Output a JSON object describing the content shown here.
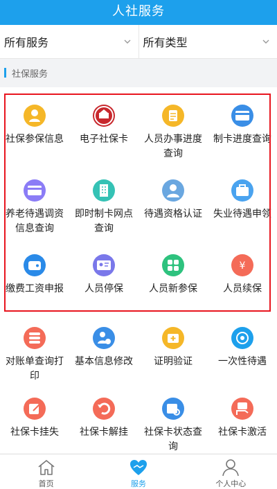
{
  "header": {
    "title": "人社服务"
  },
  "filters": {
    "service": "所有服务",
    "type": "所有类型"
  },
  "section": {
    "title": "社保服务"
  },
  "services": [
    {
      "label": "社保参保信息",
      "icon": "person-icon",
      "color": "#f5b728"
    },
    {
      "label": "电子社保卡",
      "icon": "emblem-icon",
      "color": "#c8282d"
    },
    {
      "label": "人员办事进度查询",
      "icon": "document-icon",
      "color": "#f5b728"
    },
    {
      "label": "制卡进度查询",
      "icon": "card-icon",
      "color": "#3a8ee6"
    },
    {
      "label": "养老待遇调资信息查询",
      "icon": "card-icon",
      "color": "#8b7cf6"
    },
    {
      "label": "即时制卡网点查询",
      "icon": "building-icon",
      "color": "#35c2b5"
    },
    {
      "label": "待遇资格认证",
      "icon": "doctor-icon",
      "color": "#6aa7e0"
    },
    {
      "label": "失业待遇申领",
      "icon": "briefcase-icon",
      "color": "#4aa3ef"
    },
    {
      "label": "缴费工资申报",
      "icon": "wallet-icon",
      "color": "#2a8ae8"
    },
    {
      "label": "人员停保",
      "icon": "id-card-icon",
      "color": "#7a78ea"
    },
    {
      "label": "人员新参保",
      "icon": "grid-icon",
      "color": "#2ec27e"
    },
    {
      "label": "人员续保",
      "icon": "yuan-hand-icon",
      "color": "#f46b58"
    },
    {
      "label": "对账单查询打印",
      "icon": "stack-icon",
      "color": "#f46b58"
    },
    {
      "label": "基本信息修改",
      "icon": "user-edit-icon",
      "color": "#3a8ee6"
    },
    {
      "label": "证明验证",
      "icon": "medical-box-icon",
      "color": "#f5b728"
    },
    {
      "label": "一次性待遇",
      "icon": "coin-icon",
      "color": "#1da0ec"
    },
    {
      "label": "社保卡挂失",
      "icon": "edit-icon",
      "color": "#f46b58"
    },
    {
      "label": "社保卡解挂",
      "icon": "undo-icon",
      "color": "#f46b58"
    },
    {
      "label": "社保卡状态查询",
      "icon": "calendar-search-icon",
      "color": "#3a8ee6"
    },
    {
      "label": "社保卡激活",
      "icon": "hand-card-icon",
      "color": "#f46b58"
    }
  ],
  "bottom_nav": [
    {
      "label": "首页",
      "icon": "home-icon"
    },
    {
      "label": "服务",
      "icon": "heart-hands-icon",
      "active": true
    },
    {
      "label": "个人中心",
      "icon": "user-icon"
    }
  ],
  "colors": {
    "primary": "#1da0ec",
    "highlight_border": "#e8141e"
  }
}
